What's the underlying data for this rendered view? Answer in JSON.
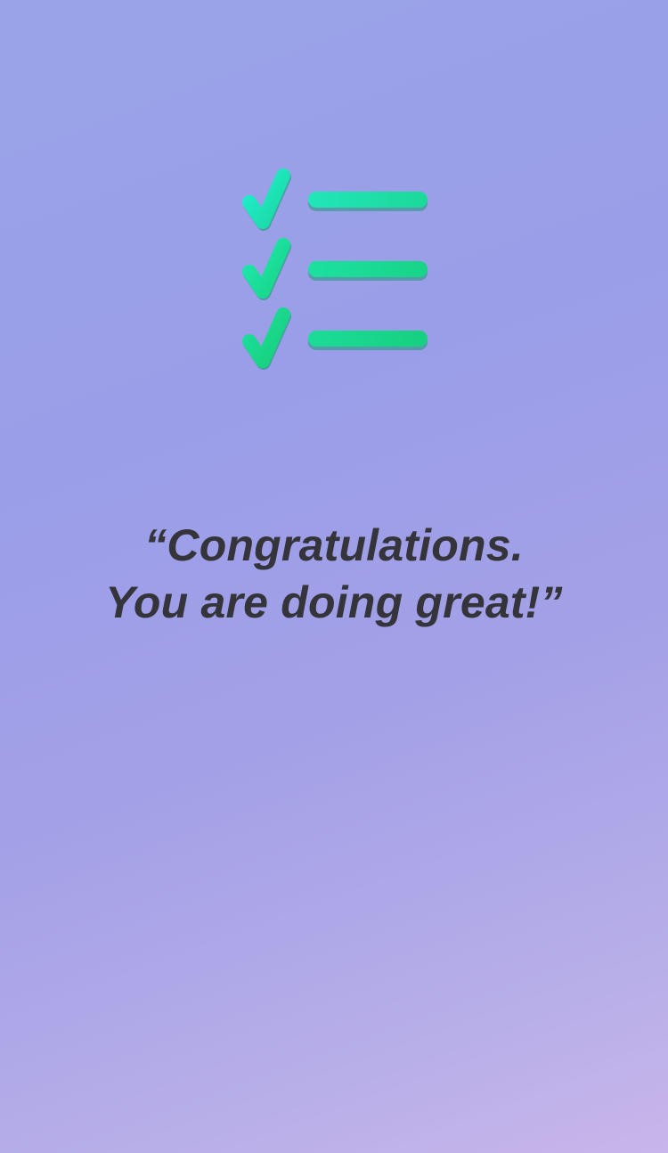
{
  "screen": {
    "icon": "checklist-icon",
    "message_line1": "“Congratulations.",
    "message_line2": "You are doing great!”"
  },
  "colors": {
    "accent_green": "#1fd690",
    "accent_teal": "#22e8c8",
    "text": "#34343a",
    "background_top": "#9aa3e8",
    "background_bottom": "#c8b5eb"
  }
}
